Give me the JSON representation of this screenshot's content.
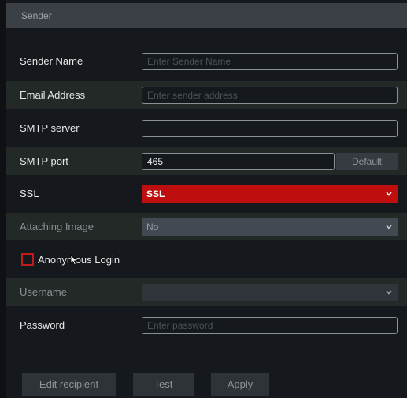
{
  "header": {
    "title": "Sender"
  },
  "form": {
    "sender_name": {
      "label": "Sender Name",
      "placeholder": "Enter Sender Name"
    },
    "email_address": {
      "label": "Email Address",
      "placeholder": "Enter sender address"
    },
    "smtp_server": {
      "label": "SMTP server",
      "placeholder": ""
    },
    "smtp_port": {
      "label": "SMTP port",
      "value": "465",
      "default_label": "Default"
    },
    "ssl": {
      "label": "SSL",
      "value": "SSL"
    },
    "attaching_image": {
      "label": "Attaching Image",
      "value": "No"
    },
    "anonymous_login": {
      "label": "Anonymous Login",
      "checked": false
    },
    "username": {
      "label": "Username",
      "value": ""
    },
    "password": {
      "label": "Password",
      "placeholder": "Enter password"
    }
  },
  "buttons": {
    "edit_recipient": "Edit recipient",
    "test": "Test",
    "apply": "Apply"
  },
  "icons": {
    "dropdown": "chevron-down-icon",
    "cursor": "mouse-pointer-icon"
  },
  "colors": {
    "accent": "#bf0e0e",
    "header_bg": "#3a4046",
    "panel_bg": "#15181c"
  }
}
